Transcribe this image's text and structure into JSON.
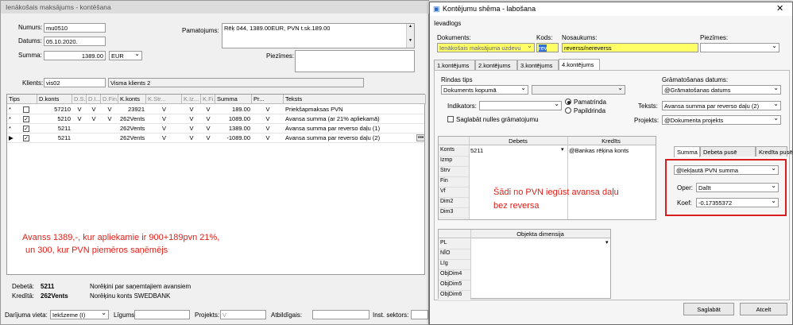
{
  "main_window": {
    "title": "Ienākošais maksājums - kontēšana",
    "numurs_label": "Numurs:",
    "numurs_value": "mu0510",
    "datums_label": "Datums:",
    "datums_value": "05.10.2020.",
    "summa_label": "Summa:",
    "summa_value": "1389.00",
    "currency": "EUR",
    "pamatojums_label": "Pamatojums:",
    "pamatojums_value": "Rēķ 044, 1389.00EUR, PVN t.sk.189.00",
    "piezimes_label": "Piezīmes:",
    "klients_label": "Klients:",
    "klients_code": "vis02",
    "klients_name": "Visma klients 2",
    "columns": [
      "Tips",
      "D.konts",
      "D.S...",
      "D.I...",
      "D.Fin...",
      "K.konts",
      "K.Str...",
      "K.Iz...",
      "K.Fi...",
      "Summa",
      "Pr...",
      "Teksts"
    ],
    "rows": [
      {
        "marker": "*",
        "checked": false,
        "dkonts": "57210",
        "ds": "V",
        "di": "V",
        "dfin": "V",
        "kkonts": "23921",
        "kstr": "V",
        "kiz": "V",
        "kfi": "V",
        "summa": "189.00",
        "pr": "V",
        "teksts": "Priekšapmaksas PVN"
      },
      {
        "marker": "*",
        "checked": true,
        "dkonts": "5210",
        "ds": "V",
        "di": "V",
        "dfin": "V",
        "kkonts": "262Vents",
        "kstr": "V",
        "kiz": "V",
        "kfi": "V",
        "summa": "1089.00",
        "pr": "V",
        "teksts": "Avansa summa (ar 21% apliekamā)"
      },
      {
        "marker": "*",
        "checked": true,
        "dkonts": "5211",
        "ds": "",
        "di": "",
        "dfin": "",
        "kkonts": "262Vents",
        "kstr": "V",
        "kiz": "V",
        "kfi": "V",
        "summa": "1389.00",
        "pr": "V",
        "teksts": "Avansa summa par reverso daļu (1)"
      },
      {
        "marker": "▶",
        "checked": true,
        "dkonts": "5211",
        "ds": "",
        "di": "",
        "dfin": "",
        "kkonts": "262Vents",
        "kstr": "V",
        "kiz": "V",
        "kfi": "V",
        "summa": "-1089.00",
        "pr": "V",
        "teksts": "Avansa summa par reverso daļu (2)"
      }
    ],
    "annotation_line1": "Avanss 1389,-, kur apliekamie ir 900+189pvn 21%,",
    "annotation_line2": "un 300, kur PVN piemēros saņēmējs",
    "debeta_label": "Debetā:",
    "debeta_code": "5211",
    "debeta_name": "Norēķini par saņemtajiem avansiem",
    "kredita_label": "Kredītā:",
    "kredita_code": "262Vents",
    "kredita_name": "Norēķinu konts SWEDBANK",
    "darijuma_label": "Darījuma vieta:",
    "darijuma_value": "Iekšzeme (I)",
    "ligums_label": "Līgums:",
    "projekts_label": "Projekts:",
    "projekts_value": "V",
    "atbildigais_label": "Atbildīgais:",
    "inst_label": "Inst. sektors:"
  },
  "dialog": {
    "title": "Kontējumu shēma - labošana",
    "section": "Ievadlogs",
    "dokuments_label": "Dokuments:",
    "dokuments_value": "Ienākošais maksājuma uzdevu",
    "kods_label": "Kods:",
    "kods_value": "rev",
    "nosaukums_label": "Nosaukums:",
    "nosaukums_value": "reverss/nereverss",
    "piezimes_label": "Piezīmes:",
    "tabs": [
      "1.kontējums",
      "2.kontējums",
      "3.kontējums",
      "4.kontējums"
    ],
    "rindas_tips_label": "Rindas tips",
    "rindas_tips_value": "Dokuments kopumā",
    "indikators_label": "Indikators:",
    "radio_pamatrinda": "Pamatrinda",
    "radio_papildrinda": "Papildrinda",
    "saglabat_nulles": "Saglabāt nulles grāmatojumu",
    "gramatosanas_label": "Grāmatošanas datums:",
    "gramatosanas_value": "@Grāmatošanas datums",
    "teksts_label": "Teksts:",
    "teksts_value": "Avansa summa par reverso daļu (2)",
    "projekts_label": "Projekts:",
    "projekts_value": "@Dokumenta projekts",
    "debets_header": "Debets",
    "kredits_header": "Kredīts",
    "row_labels": [
      "Konts",
      "Izmp",
      "Strv",
      "Fin",
      "Vf",
      "Dim2",
      "Dim3"
    ],
    "konts_debets": "5211",
    "konts_kredits": "@Bankas rēķina konts",
    "annotation_line1": "Šādi no PVN iegūst avansa daļu",
    "annotation_line2": "bez reversa",
    "summa_tabs": [
      "Summa",
      "Debeta pusē",
      "Kredīta pusē"
    ],
    "summa_value": "@Iekļautā PVN summa",
    "oper_label": "Oper:",
    "oper_value": "Dalīt",
    "koef_label": "Koef:",
    "koef_value": "-0.17355372",
    "objekta_header": "Objekta dimensija",
    "obj_labels": [
      "PL",
      "NĪO",
      "Līg",
      "ObjDim4",
      "ObjDim5",
      "ObjDim6"
    ],
    "save_button": "Saglabāt",
    "cancel_button": "Atcelt"
  }
}
